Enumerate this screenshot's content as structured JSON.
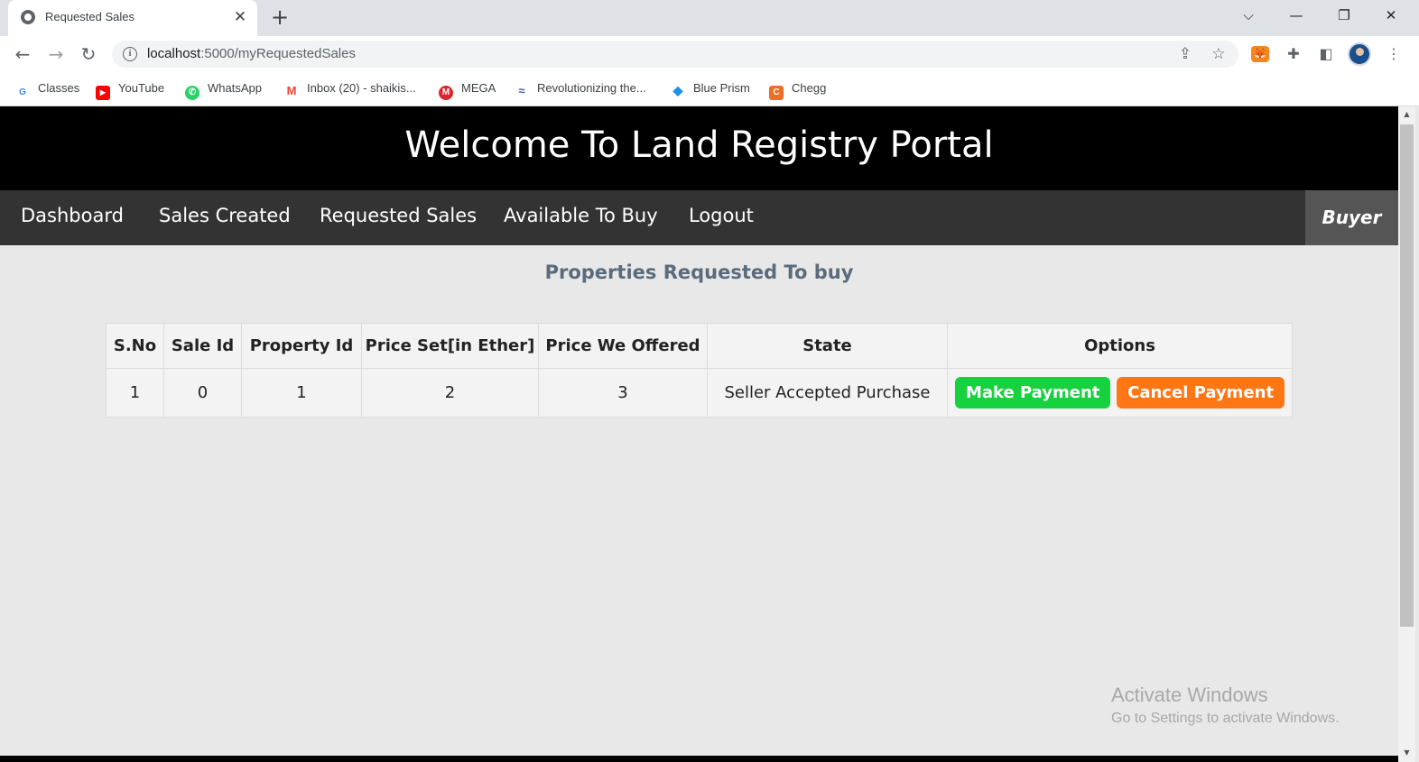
{
  "browser": {
    "tab_title": "Requested Sales",
    "tab_close": "✕",
    "new_tab": "+",
    "url_host": "localhost",
    "url_path": ":5000/myRequestedSales",
    "bookmarks": [
      {
        "label": "Classes",
        "icon": "google-icon",
        "color": "#4285f4",
        "glyph": "G"
      },
      {
        "label": "YouTube",
        "icon": "youtube-icon",
        "color": "#ff0000",
        "glyph": "▶"
      },
      {
        "label": "WhatsApp",
        "icon": "whatsapp-icon",
        "color": "#25d366",
        "glyph": "✆"
      },
      {
        "label": "Inbox (20) - shaikis...",
        "icon": "gmail-icon",
        "color": "#ea4335",
        "glyph": "M"
      },
      {
        "label": "MEGA",
        "icon": "mega-icon",
        "color": "#d9272e",
        "glyph": "M"
      },
      {
        "label": "Revolutionizing the...",
        "icon": "bookmark-site-icon",
        "color": "#3a5ba0",
        "glyph": "≈"
      },
      {
        "label": "Blue Prism",
        "icon": "blue-prism-icon",
        "color": "#1e90e8",
        "glyph": "◆"
      },
      {
        "label": "Chegg",
        "icon": "chegg-icon",
        "color": "#f26d21",
        "glyph": "C"
      }
    ]
  },
  "page": {
    "hero_title": "Welcome To Land Registry Portal",
    "nav": [
      "Dashboard",
      "Sales Created",
      "Requested Sales",
      "Available To Buy",
      "Logout"
    ],
    "role": "Buyer",
    "section_title": "Properties Requested To buy",
    "table": {
      "headers": [
        "S.No",
        "Sale Id",
        "Property Id",
        "Price Set[in Ether]",
        "Price We Offered",
        "State",
        "Options"
      ],
      "rows": [
        {
          "sno": "1",
          "sale_id": "0",
          "property_id": "1",
          "price_set": "2",
          "price_offered": "3",
          "state": "Seller Accepted Purchase",
          "pay_label": "Make Payment",
          "cancel_label": "Cancel Payment"
        }
      ]
    },
    "watermark": {
      "line1": "Activate Windows",
      "line2": "Go to Settings to activate Windows."
    }
  },
  "colors": {
    "hero_bg": "#000000",
    "navbar_bg": "#333333",
    "role_bg": "#555555",
    "section_title": "#5a6b7b",
    "make_payment": "#17d13f",
    "cancel_payment": "#ff7614"
  }
}
